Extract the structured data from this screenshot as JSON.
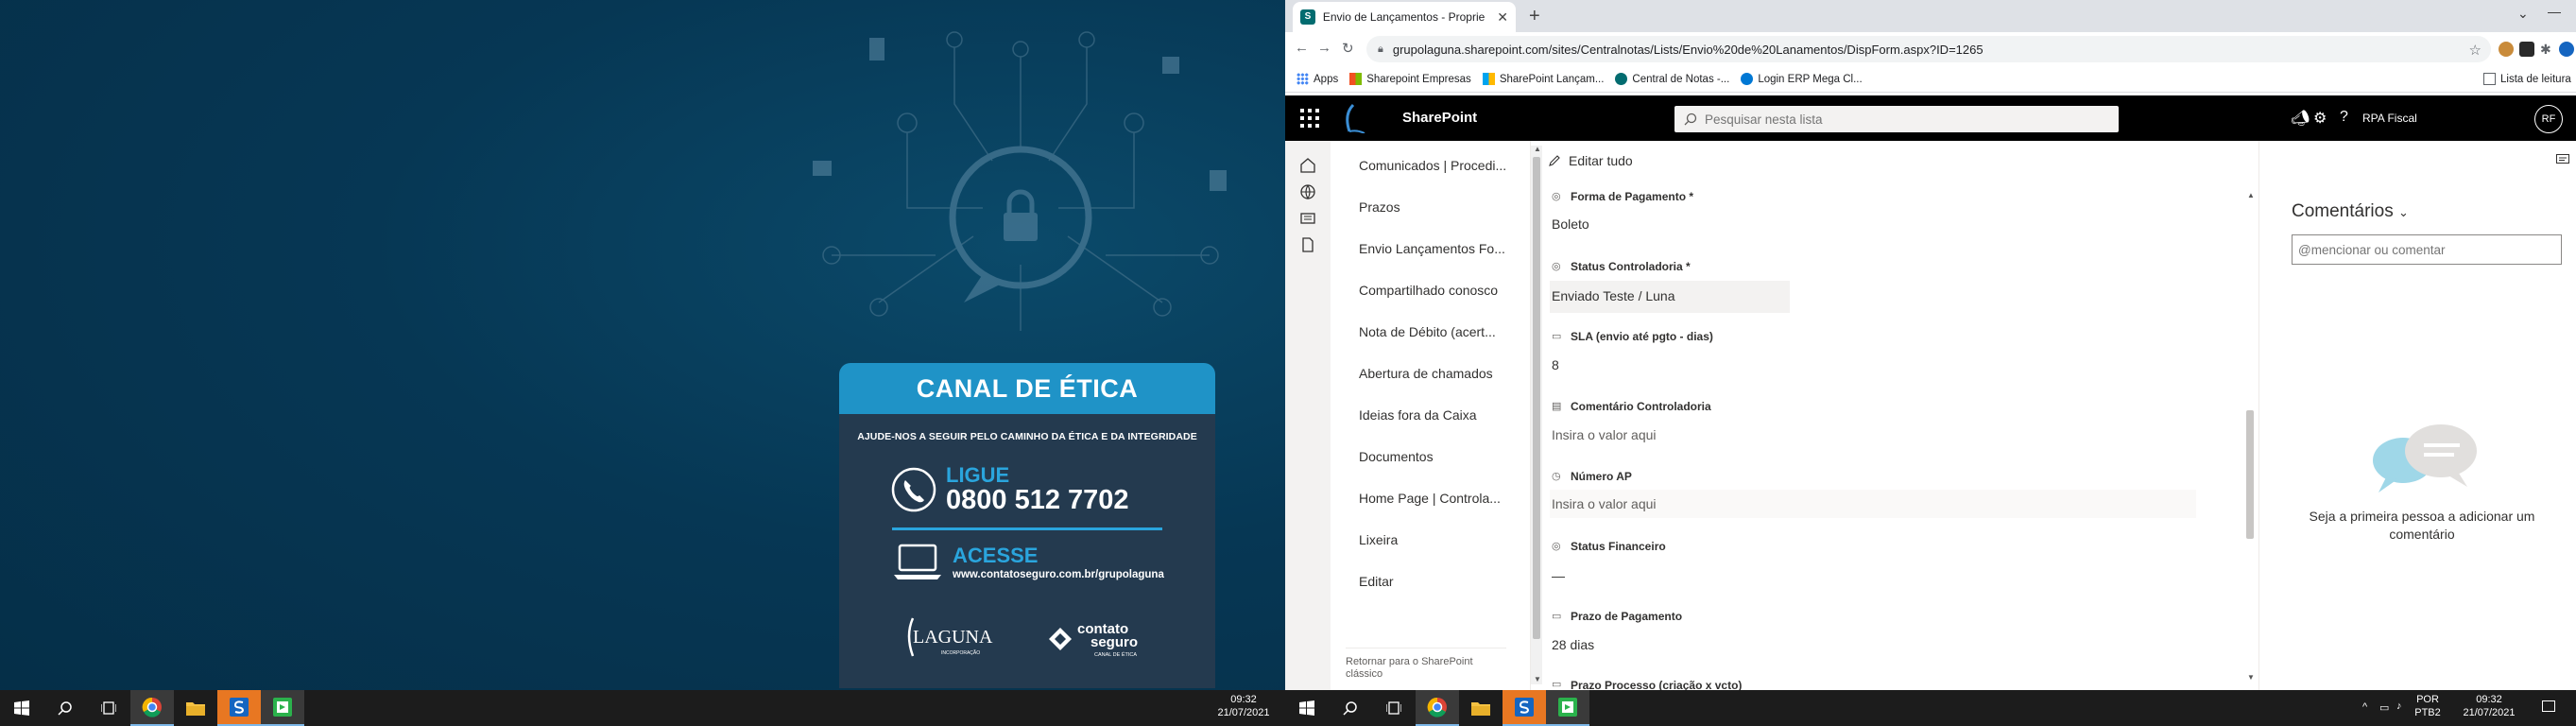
{
  "left_monitor": {
    "ethics_card": {
      "title": "CANAL DE ÉTICA",
      "tagline": "AJUDE-NOS A SEGUIR PELO CAMINHO DA ÉTICA E DA INTEGRIDADE",
      "phone_label": "LIGUE",
      "phone_number": "0800 512 7702",
      "web_label": "ACESSE",
      "web_url": "www.contatoseguro.com.br/grupolaguna",
      "logo_laguna": "LAGUNA",
      "logo_laguna_sub": "INCORPORAÇÃO",
      "logo_contato": "contato",
      "logo_seguro": "seguro",
      "logo_contato_sub": "CANAL DE ÉTICA"
    },
    "taskbar": {
      "time": "09:32",
      "date": "21/07/2021"
    }
  },
  "browser": {
    "tab_title": "Envio de Lançamentos - Proprie",
    "url": "grupolaguna.sharepoint.com/sites/Centralnotas/Lists/Envio%20de%20Lanamentos/DispForm.aspx?ID=1265",
    "bookmarks": [
      {
        "label": "Apps",
        "icon": "apps-grid-icon"
      },
      {
        "label": "Sharepoint Empresas",
        "icon": "ms-logo-icon"
      },
      {
        "label": "SharePoint Lançam...",
        "icon": "ms-logo-icon"
      },
      {
        "label": "Central de Notas -...",
        "icon": "sharepoint-icon"
      },
      {
        "label": "Login ERP Mega Cl...",
        "icon": "erp-icon"
      }
    ],
    "reading_list": "Lista de leitura"
  },
  "sharepoint": {
    "app_name": "SharePoint",
    "search_placeholder": "Pesquisar nesta lista",
    "user_name": "RPA Fiscal",
    "user_initials": "RF",
    "nav_items": [
      "Comunicados | Procedi...",
      "Prazos",
      "Envio Lançamentos Fo...",
      "Compartilhado conosco",
      "Nota de Débito (acert...",
      "Abertura de chamados",
      "Ideias fora da Caixa",
      "Documentos",
      "Home Page | Controla...",
      "Lixeira",
      "Editar"
    ],
    "nav_return": "Retornar para o SharePoint clássico",
    "edit_all": "Editar tudo",
    "fields": [
      {
        "label": "Forma de Pagamento *",
        "value": "Boleto",
        "icon": "choice-icon",
        "placeholder": false
      },
      {
        "label": "Status Controladoria *",
        "value": "Enviado Teste / Luna",
        "icon": "choice-icon",
        "placeholder": false
      },
      {
        "label": "SLA (envio até pgto - dias)",
        "value": "8",
        "icon": "number-icon",
        "placeholder": false
      },
      {
        "label": "Comentário Controladoria",
        "value": "Insira o valor aqui",
        "icon": "text-icon",
        "placeholder": true
      },
      {
        "label": "Número AP",
        "value": "Insira o valor aqui",
        "icon": "number-icon",
        "placeholder": true
      },
      {
        "label": "Status Financeiro",
        "value": "—",
        "icon": "choice-icon",
        "placeholder": false
      },
      {
        "label": "Prazo de Pagamento",
        "value": "28 dias",
        "icon": "calc-icon",
        "placeholder": false
      },
      {
        "label": "Prazo Processo (criação x vcto)",
        "value": "",
        "icon": "calc-icon",
        "placeholder": false
      }
    ],
    "comments_title": "Comentários",
    "comments_placeholder": "@mencionar ou comentar",
    "comments_empty": "Seja a primeira pessoa a adicionar um comentário"
  },
  "right_taskbar": {
    "lang_top": "POR",
    "lang_bottom": "PTB2",
    "time": "09:32",
    "date": "21/07/2021"
  },
  "colors": {
    "wallpaper": "#063754",
    "ethics_header": "#1f93c7",
    "ethics_accent": "#2aa5dd",
    "suite_bar": "#000000",
    "taskbar": "#1c1c1c"
  }
}
